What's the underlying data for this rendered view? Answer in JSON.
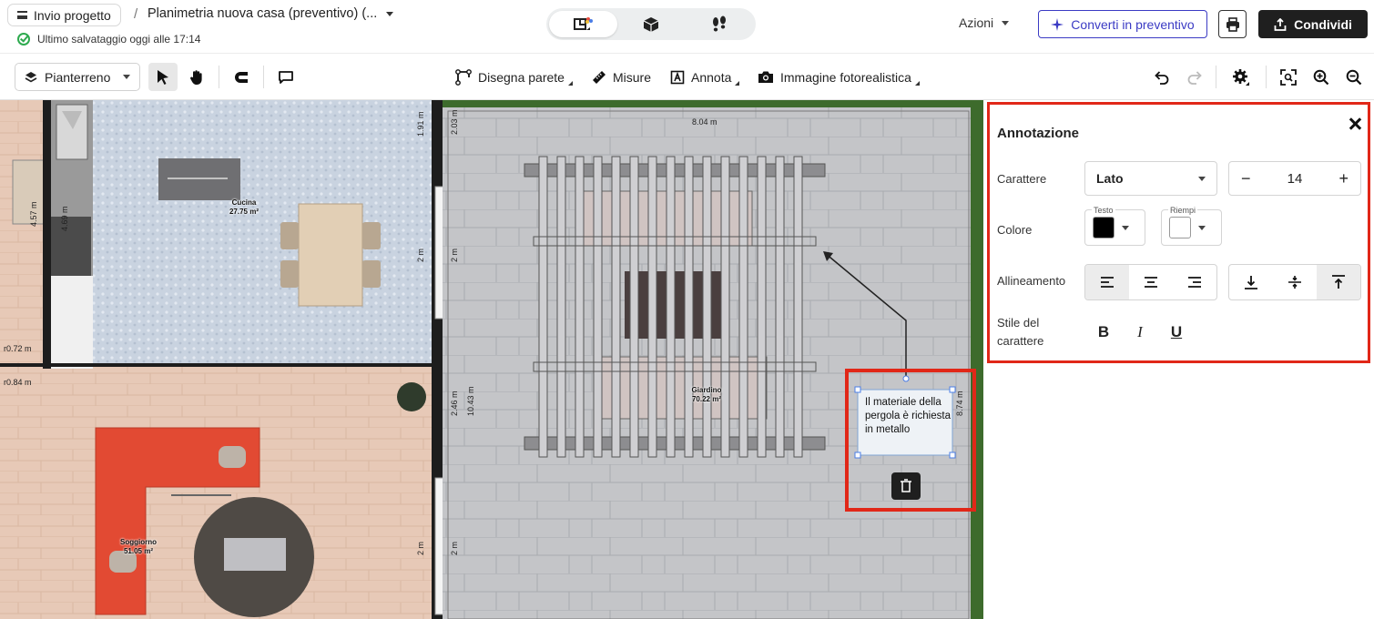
{
  "header": {
    "back_label": "Invio progetto",
    "separator": "/",
    "project_title": "Planimetria nuova casa (preventivo) (...",
    "save_status": "Ultimo salvataggio oggi alle 17:14",
    "actions_label": "Azioni",
    "convert_label": "Converti in preventivo",
    "share_label": "Condividi",
    "view_modes": [
      "2D plan",
      "3D view",
      "Walkthrough"
    ],
    "active_view": "2D plan"
  },
  "toolbar": {
    "floor": "Pianterreno",
    "draw_wall": "Disegna parete",
    "measures": "Misure",
    "annotate": "Annota",
    "photo": "Immagine fotorealistica"
  },
  "canvas": {
    "rooms": [
      {
        "name": "Cucina",
        "area": "27.75 m²"
      },
      {
        "name": "Giardino",
        "area": "70.22 m²"
      },
      {
        "name": "Soggiorno",
        "area": "51.05 m²"
      }
    ],
    "measurements": {
      "top_width": "8.04 m",
      "m203": "2.03 m",
      "m191": "1.91 m",
      "m2a": "2 m",
      "m2b": "2 m",
      "m2c": "2 m",
      "m2d": "2 m",
      "m246": "2.46 m",
      "m1043": "10.43 m",
      "m874": "8.74 m",
      "m457": "4.57 m",
      "m469": "4.69 m",
      "m072": "r0.72 m",
      "m084": "r0.84 m"
    },
    "annotation_text": "Il materiale della pergola è richiesta in metallo"
  },
  "panel": {
    "title": "Annotazione",
    "font_label": "Carattere",
    "font_value": "Lato",
    "font_size": "14",
    "color_label": "Colore",
    "text_color_caption": "Testo",
    "fill_color_caption": "Riempi",
    "text_color": "#000000",
    "fill_color": "#ffffff",
    "align_label": "Allineamento",
    "style_label_line1": "Stile del",
    "style_label_line2": "carattere",
    "bold": "B",
    "italic": "I",
    "underline": "U"
  },
  "colors": {
    "accent": "#3b3bc4",
    "highlight": "#e12718",
    "share_bg": "#1f1f1f"
  }
}
